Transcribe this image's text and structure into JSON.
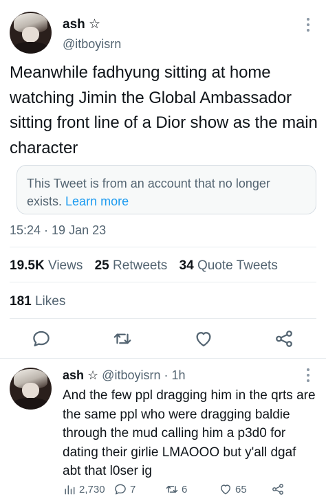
{
  "main_tweet": {
    "author": {
      "display_name": "ash ☆",
      "handle": "@itboyisrn",
      "avatar_icon": "anime-avatar-icon"
    },
    "text": "Meanwhile fadhyung sitting at home watching Jimin the Global Ambassador sitting front line of a Dior show as the main character",
    "notice": {
      "text": "This Tweet is from an account that no longer exists.",
      "link": "Learn more"
    },
    "timestamp": "15:24 · 19 Jan 23",
    "stats": {
      "views_count": "19.5K",
      "views_label": "Views",
      "retweets_count": "25",
      "retweets_label": "Retweets",
      "quotes_count": "34",
      "quotes_label": "Quote Tweets"
    },
    "likes": {
      "count": "181",
      "label": "Likes"
    },
    "actions": [
      "reply-icon",
      "retweet-icon",
      "like-icon",
      "share-icon"
    ]
  },
  "reply": {
    "display_name": "ash ☆",
    "handle_time": "@itboyisrn · 1h",
    "text": "And the few ppl dragging him in the qrts are the same ppl who were dragging baldie through the mud calling him a p3d0 for dating their girlie LMAOOO but y'all dgaf abt that l0ser ig",
    "views": "2,730",
    "replies": "7",
    "retweets": "6",
    "likes": "65"
  },
  "colors": {
    "accent": "#1d9bf0",
    "text": "#0f1419",
    "muted": "#536471",
    "border": "#e7ebee"
  }
}
